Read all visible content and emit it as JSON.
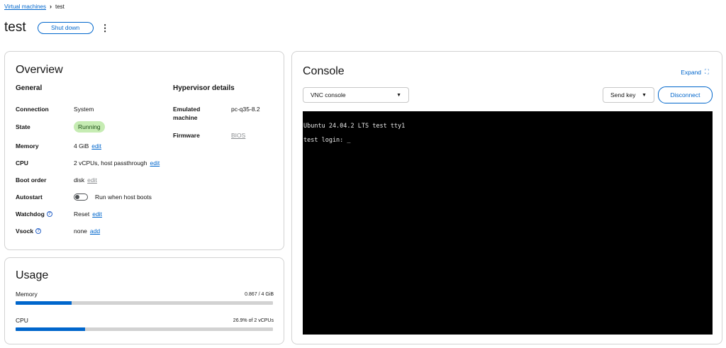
{
  "breadcrumb": {
    "parent": "Virtual machines",
    "current": "test"
  },
  "header": {
    "title": "test",
    "shutdown_label": "Shut down",
    "kebab": "⋮"
  },
  "overview": {
    "title": "Overview",
    "general_title": "General",
    "hypervisor_title": "Hypervisor details",
    "connection_label": "Connection",
    "connection_value": "System",
    "state_label": "State",
    "state_value": "Running",
    "memory_label": "Memory",
    "memory_value": "4 GiB",
    "memory_edit": "edit",
    "cpu_label": "CPU",
    "cpu_value": "2 vCPUs, host passthrough",
    "cpu_edit": "edit",
    "boot_label": "Boot order",
    "boot_value": "disk",
    "boot_edit": "edit",
    "autostart_label": "Autostart",
    "autostart_value": "Run when host boots",
    "watchdog_label": "Watchdog",
    "watchdog_value": "Reset",
    "watchdog_edit": "edit",
    "vsock_label": "Vsock",
    "vsock_value": "none",
    "vsock_add": "add",
    "emulated_label_1": "Emulated",
    "emulated_label_2": "machine",
    "emulated_value": "pc-q35-8.2",
    "firmware_label": "Firmware",
    "firmware_value": "BIOS",
    "help_glyph": "?"
  },
  "usage": {
    "title": "Usage",
    "memory_label": "Memory",
    "memory_value": "0.867 / 4 GiB",
    "memory_fraction": 0.2168,
    "cpu_label": "CPU",
    "cpu_value": "26.9% of 2 vCPUs",
    "cpu_fraction": 0.269
  },
  "console": {
    "title": "Console",
    "expand_label": "Expand",
    "expand_icon": "⛶",
    "console_type": "VNC console",
    "send_key_label": "Send key",
    "disconnect_label": "Disconnect",
    "caret": "▼",
    "terminal_line_1": "Ubuntu 24.04.2 LTS test tty1",
    "terminal_line_2": "test login: _"
  },
  "colors": {
    "accent": "#0066cc",
    "running_bg": "#c6ecb3",
    "terminal_bg": "#000000"
  }
}
